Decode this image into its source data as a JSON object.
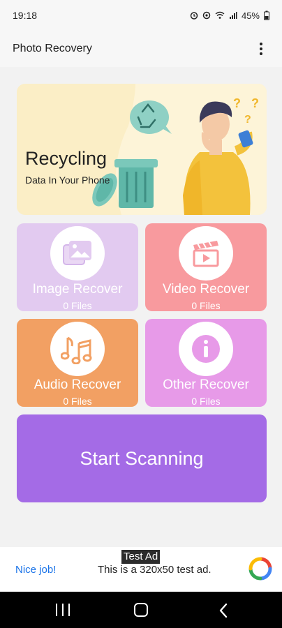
{
  "status_bar": {
    "time": "19:18",
    "battery": "45%",
    "icons": [
      "alarm-icon",
      "nfc-icon",
      "wifi-icon",
      "signal-icon",
      "battery-icon"
    ]
  },
  "app_bar": {
    "title": "Photo Recovery",
    "menu_icon": "more-vert-icon"
  },
  "banner": {
    "title": "Recycling",
    "subtitle": "Data In Your Phone"
  },
  "cards": [
    {
      "title": "Image Recover",
      "count": "0 Files",
      "icon": "image-icon",
      "color": "#e2caf0"
    },
    {
      "title": "Video Recover",
      "count": "0 Files",
      "icon": "clapperboard-icon",
      "color": "#f89a9e"
    },
    {
      "title": "Audio Recover",
      "count": "0 Files",
      "icon": "music-notes-icon",
      "color": "#f2a063"
    },
    {
      "title": "Other Recover",
      "count": "0 Files",
      "icon": "info-icon",
      "color": "#e79ae8"
    }
  ],
  "scan_button": {
    "label": "Start Scanning",
    "color": "#a46be6"
  },
  "ad": {
    "badge": "Test Ad",
    "left_text": "Nice job!",
    "text": "This is a 320x50 test ad."
  },
  "nav_bar": {
    "icons": [
      "recent-apps-icon",
      "home-icon",
      "back-icon"
    ]
  }
}
